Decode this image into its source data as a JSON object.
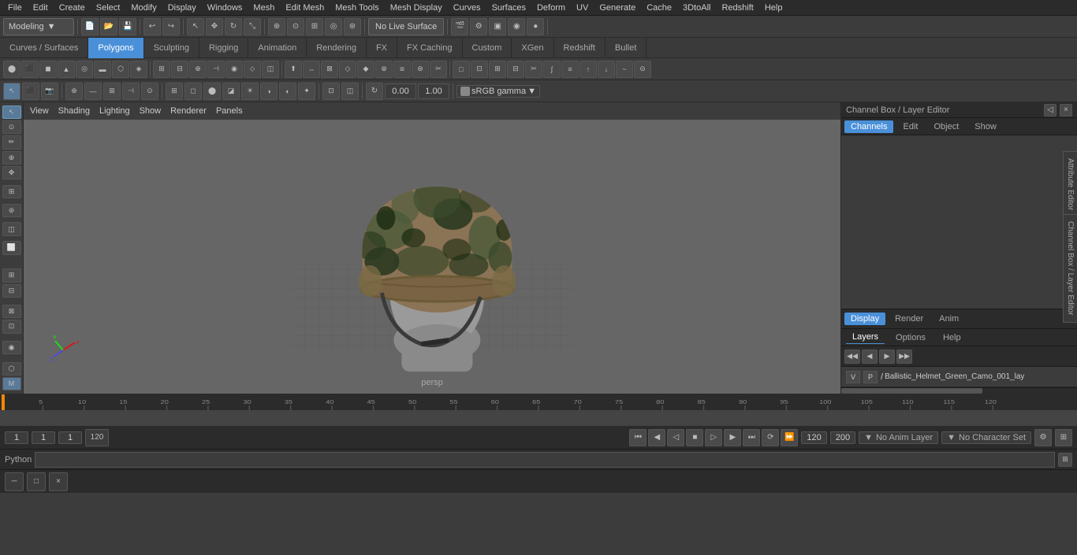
{
  "menu": {
    "items": [
      "File",
      "Edit",
      "Create",
      "Select",
      "Modify",
      "Display",
      "Windows",
      "Mesh",
      "Edit Mesh",
      "Mesh Tools",
      "Mesh Display",
      "Curves",
      "Surfaces",
      "Deform",
      "UV",
      "Generate",
      "Cache",
      "3DtoAll",
      "Redshift",
      "Help"
    ]
  },
  "toolbar1": {
    "workspace_label": "Modeling",
    "live_surface_label": "No Live Surface"
  },
  "tabs": {
    "items": [
      "Curves / Surfaces",
      "Polygons",
      "Sculpting",
      "Rigging",
      "Animation",
      "Rendering",
      "FX",
      "FX Caching",
      "Custom",
      "XGen",
      "Redshift",
      "Bullet"
    ],
    "active": "Polygons"
  },
  "viewport": {
    "menu_items": [
      "View",
      "Shading",
      "Lighting",
      "Show",
      "Renderer",
      "Panels"
    ],
    "persp_label": "persp",
    "color_space": "sRGB gamma",
    "translate_x": "0.00",
    "translate_y": "1.00"
  },
  "channel_box": {
    "title": "Channel Box / Layer Editor",
    "tabs": [
      "Channels",
      "Edit",
      "Object",
      "Show"
    ],
    "display_tabs": [
      "Display",
      "Render",
      "Anim"
    ],
    "active_display": "Display"
  },
  "layers": {
    "tabs": [
      "Layers",
      "Options",
      "Help"
    ],
    "active": "Layers",
    "layer_row": {
      "v_label": "V",
      "p_label": "P",
      "name": "Ballistic_Helmet_Green_Camo_001_lay"
    }
  },
  "timeline": {
    "ticks": [
      "",
      "5",
      "10",
      "15",
      "20",
      "25",
      "30",
      "35",
      "40",
      "45",
      "50",
      "55",
      "60",
      "65",
      "70",
      "75",
      "80",
      "85",
      "90",
      "95",
      "100",
      "105",
      "110",
      "115",
      "120"
    ]
  },
  "status_bar": {
    "frame_start": "1",
    "frame_current": "1",
    "frame_display": "1",
    "frame_end": "120",
    "frame_end2": "120",
    "frame_max": "200",
    "anim_layer": "No Anim Layer",
    "character_set": "No Character Set"
  },
  "python_bar": {
    "label": "Python"
  },
  "window_bar": {
    "buttons": [
      "□",
      "×"
    ]
  },
  "icons": {
    "select": "↖",
    "lasso": "⊙",
    "rotate": "↻",
    "scale": "⤡",
    "move": "✥",
    "snap": "⊕",
    "camera": "📷",
    "gear": "⚙",
    "grid": "⊞",
    "arrow_left": "◀",
    "arrow_right": "▶",
    "skip_start": "⏮",
    "skip_end": "⏭",
    "play": "▶",
    "stop": "■"
  }
}
